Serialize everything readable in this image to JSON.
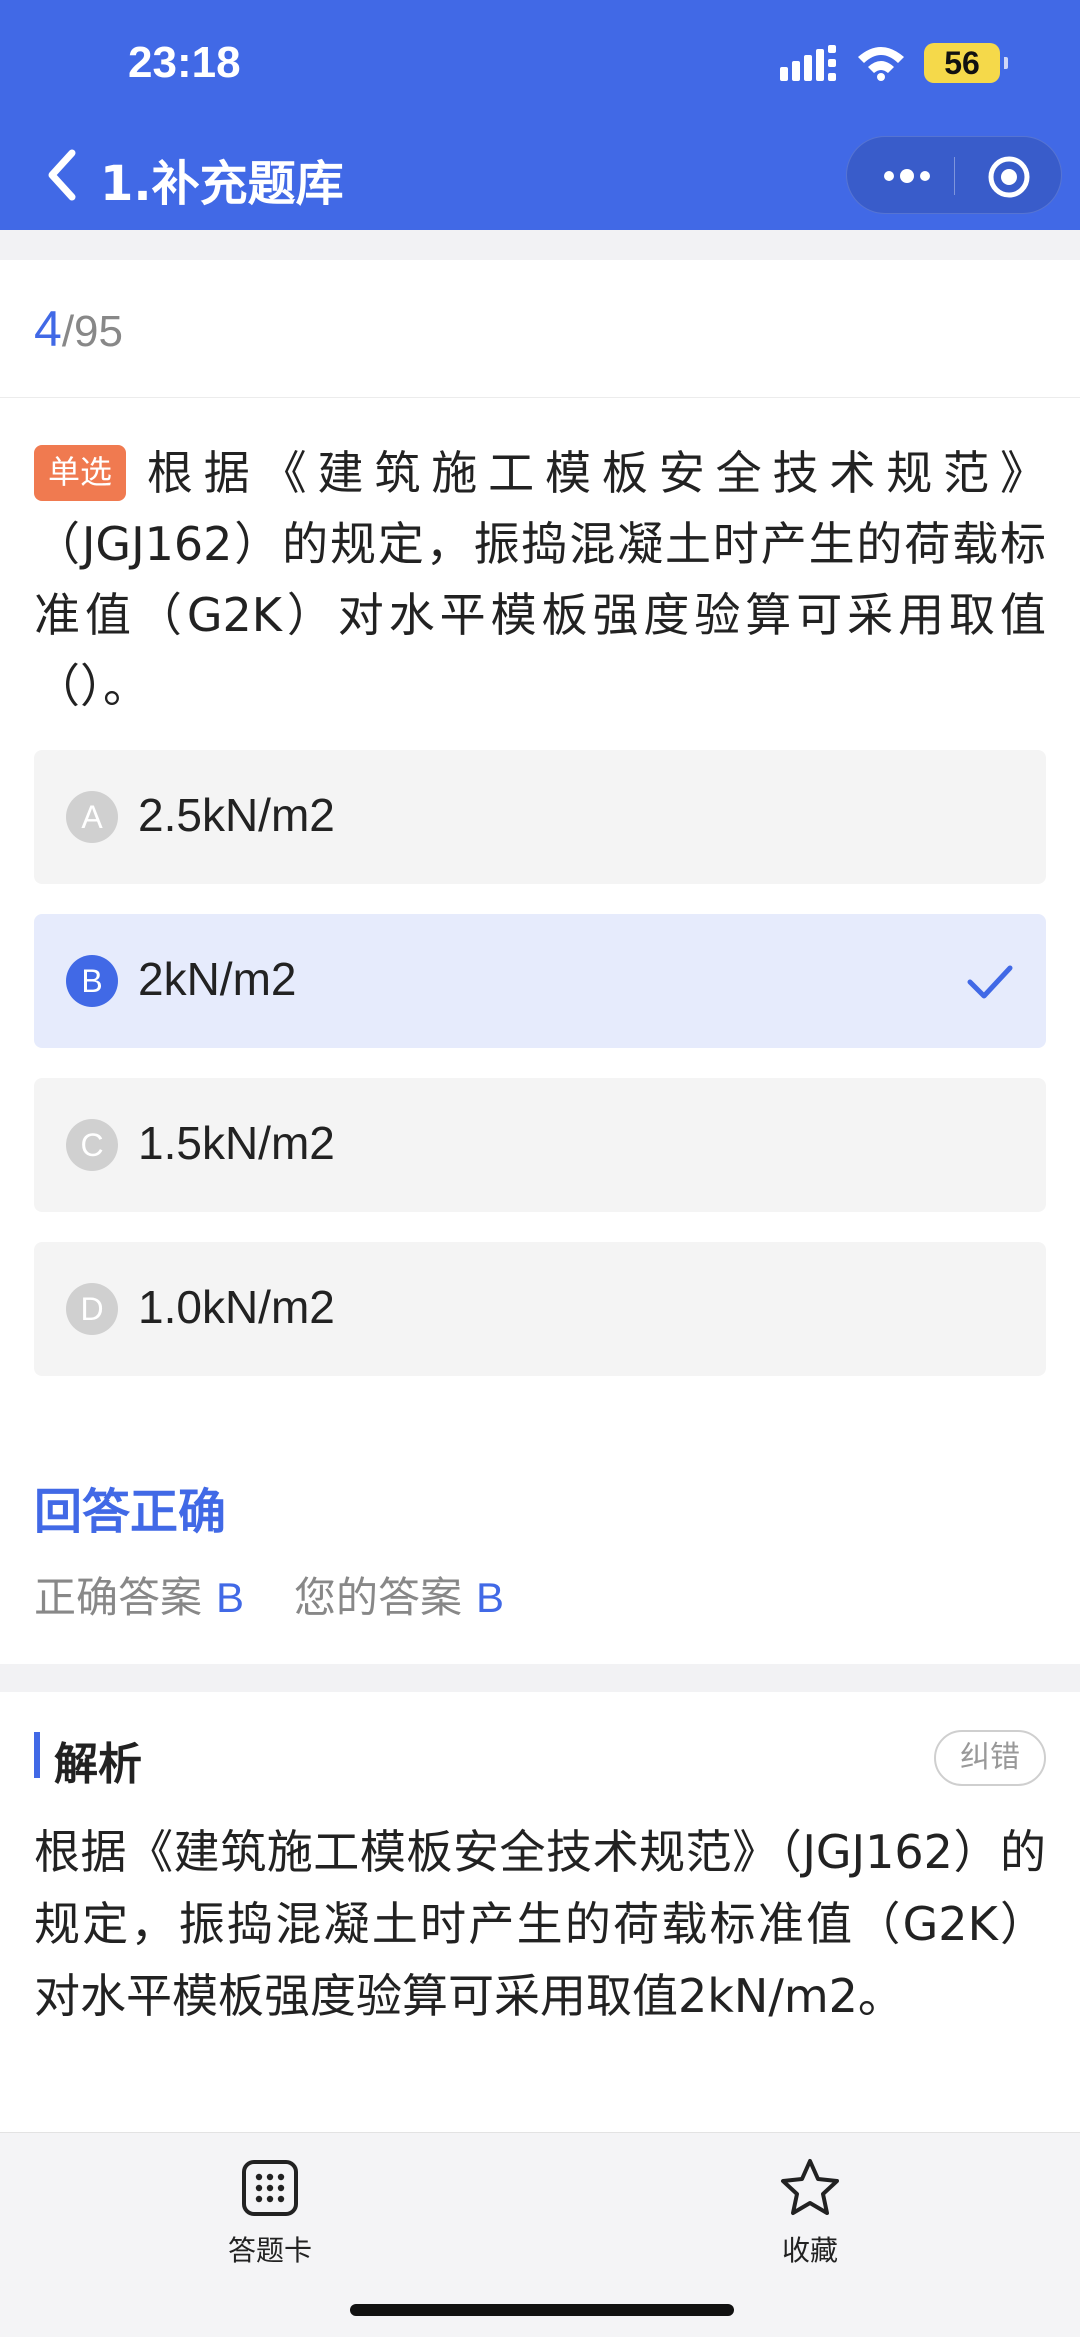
{
  "status_bar": {
    "time": "23:18",
    "battery": "56"
  },
  "nav": {
    "title": "1.补充题库"
  },
  "progress": {
    "current": "4",
    "total": "/95"
  },
  "question": {
    "type_tag": "单选",
    "text": "根据《建筑施工模板安全技术规范》（JGJ162）的规定，振捣混凝土时产生的荷载标准值（G2K）对水平模板强度验算可采用取值（）。",
    "options": [
      {
        "letter": "A",
        "text": "2.5kN/m2"
      },
      {
        "letter": "B",
        "text": "2kN/m2"
      },
      {
        "letter": "C",
        "text": "1.5kN/m2"
      },
      {
        "letter": "D",
        "text": "1.0kN/m2"
      }
    ],
    "selected_letter": "B"
  },
  "result": {
    "title": "回答正确",
    "correct_label": "正确答案",
    "correct_value": "B",
    "your_label": "您的答案",
    "your_value": "B"
  },
  "analysis": {
    "title": "解析",
    "report_button": "纠错",
    "text": "根据《建筑施工模板安全技术规范》（JGJ162）的规定，振捣混凝土时产生的荷载标准值（G2K）对水平模板强度验算可采用取值2kN/m2。"
  },
  "bottom_tabs": {
    "answer_card": "答题卡",
    "favorite": "收藏"
  },
  "colors": {
    "primary": "#4169e6",
    "tag": "#f07a50",
    "battery": "#f5d94a"
  }
}
